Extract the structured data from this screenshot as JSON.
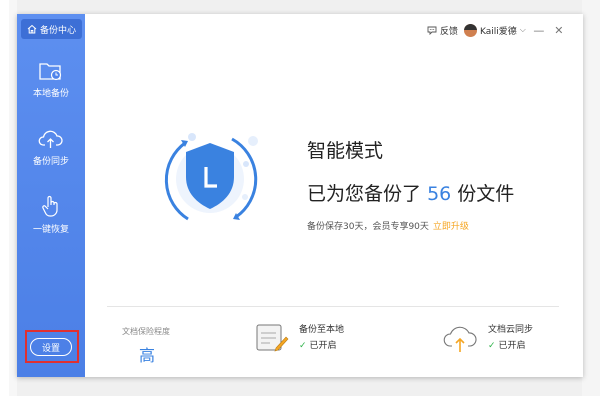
{
  "sidebar": {
    "brand": "备份中心",
    "items": [
      {
        "label": "本地备份",
        "icon": "folder-clock-icon"
      },
      {
        "label": "备份同步",
        "icon": "cloud-upload-icon"
      },
      {
        "label": "一键恢复",
        "icon": "pointer-hand-icon"
      }
    ],
    "settings_label": "设置"
  },
  "topbar": {
    "feedback_label": "反馈",
    "user_name": "Kaili爱德"
  },
  "hero": {
    "mode_title": "智能模式",
    "backup_prefix": "已为您备份了",
    "backup_count": "56",
    "backup_suffix": "份文件",
    "retention_text": "备份保存30天，会员专享90天",
    "upgrade_link": "立即升级"
  },
  "footer": {
    "protection_label": "文档保险程度",
    "protection_value": "高",
    "local_title": "备份至本地",
    "local_status": "已开启",
    "cloud_title": "文档云同步",
    "cloud_status": "已开启"
  },
  "colors": {
    "sidebar": "#4b7fe6",
    "accent": "#3a82e0",
    "upgrade": "#f5a623",
    "check": "#2fb34a"
  }
}
